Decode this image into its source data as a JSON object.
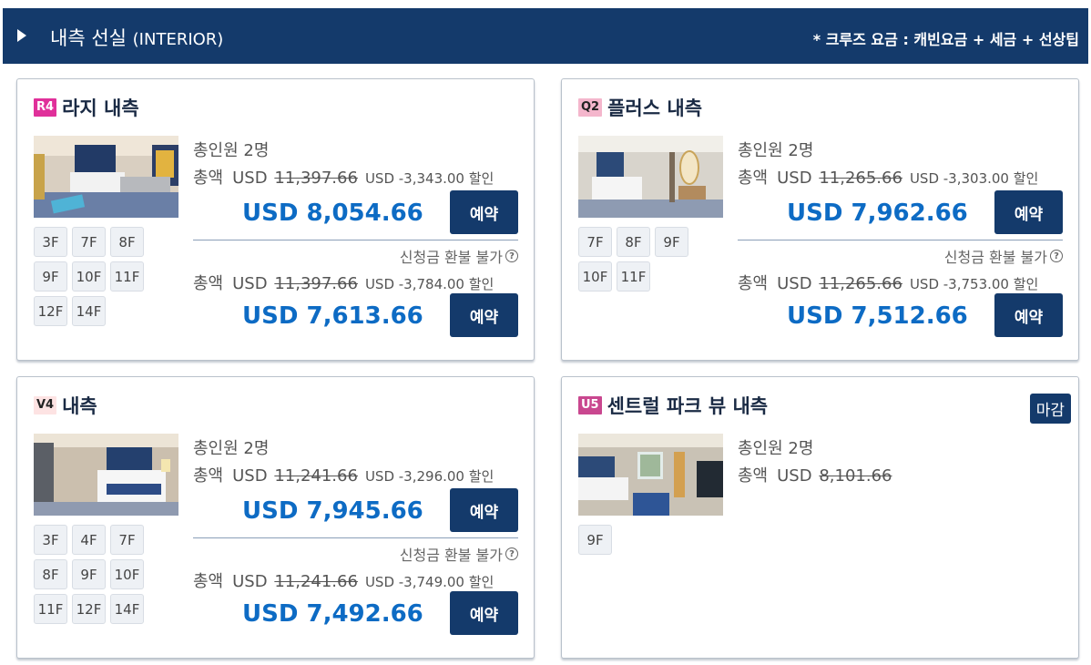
{
  "header": {
    "title": "내측 선실",
    "title_sub": "(INTERIOR)",
    "note": "* 크루즈 요금 : 캐빈요금 + 세금 + 선상팁"
  },
  "cards": [
    {
      "code": "R4",
      "code_color": "#e0309a",
      "code_text_color": "#ffffff",
      "name": "라지 내측",
      "decks": [
        "3F",
        "7F",
        "8F",
        "9F",
        "10F",
        "11F",
        "12F",
        "14F"
      ],
      "pax": "총인원 2명",
      "total_label": "총액",
      "currency": "USD",
      "offers": [
        {
          "original": "11,397.66",
          "discount": "USD -3,343.00 할인",
          "price": "USD 8,054.66",
          "book": "예약"
        },
        {
          "original": "11,397.66",
          "discount": "USD -3,784.00 할인",
          "price": "USD 7,613.66",
          "book": "예약"
        }
      ],
      "refund_note": "신청금 환불 불가"
    },
    {
      "code": "Q2",
      "code_color": "#f4b6cc",
      "code_text_color": "#222222",
      "name": "플러스 내측",
      "decks": [
        "7F",
        "8F",
        "9F",
        "10F",
        "11F"
      ],
      "pax": "총인원 2명",
      "total_label": "총액",
      "currency": "USD",
      "offers": [
        {
          "original": "11,265.66",
          "discount": "USD -3,303.00 할인",
          "price": "USD 7,962.66",
          "book": "예약"
        },
        {
          "original": "11,265.66",
          "discount": "USD -3,753.00 할인",
          "price": "USD 7,512.66",
          "book": "예약"
        }
      ],
      "refund_note": "신청금 환불 불가"
    },
    {
      "code": "V4",
      "code_color": "#fde3e3",
      "code_text_color": "#222222",
      "name": "내측",
      "decks": [
        "3F",
        "4F",
        "7F",
        "8F",
        "9F",
        "10F",
        "11F",
        "12F",
        "14F"
      ],
      "pax": "총인원 2명",
      "total_label": "총액",
      "currency": "USD",
      "offers": [
        {
          "original": "11,241.66",
          "discount": "USD -3,296.00 할인",
          "price": "USD 7,945.66",
          "book": "예약"
        },
        {
          "original": "11,241.66",
          "discount": "USD -3,749.00 할인",
          "price": "USD 7,492.66",
          "book": "예약"
        }
      ],
      "refund_note": "신청금 환불 불가"
    },
    {
      "code": "U5",
      "code_color": "#c9478f",
      "code_text_color": "#ffffff",
      "name": "센트럴 파크 뷰 내측",
      "closed_label": "마감",
      "decks": [
        "9F"
      ],
      "pax": "총인원 2명",
      "total_label": "총액",
      "currency": "USD",
      "original": "8,101.66"
    }
  ],
  "question_mark": "?"
}
